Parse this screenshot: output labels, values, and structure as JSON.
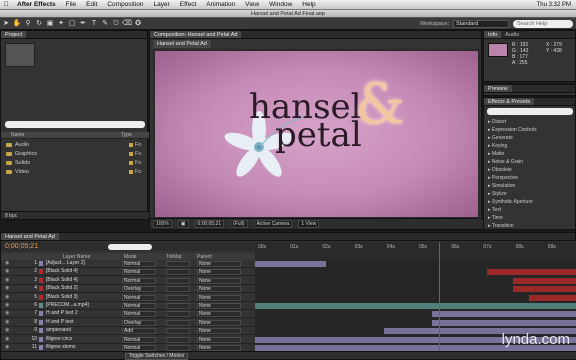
{
  "menubar": {
    "items": [
      "After Effects",
      "File",
      "Edit",
      "Composition",
      "Layer",
      "Effect",
      "Animation",
      "View",
      "Window",
      "Help"
    ],
    "right": "Thu 3:32 PM"
  },
  "window_title": "Hansel and Petal Ad Final.aep",
  "toolbar": {
    "workspace_label": "Workspace:",
    "workspace_value": "Standard",
    "search_placeholder": "Search Help"
  },
  "project": {
    "tab": "Project",
    "columns": [
      "Name",
      "Type"
    ],
    "items": [
      {
        "name": "Audio",
        "type": "Fo"
      },
      {
        "name": "Graphics",
        "type": "Fo"
      },
      {
        "name": "Solids",
        "type": "Fo"
      },
      {
        "name": "Video",
        "type": "Fo"
      }
    ],
    "bpc": "8 bpc"
  },
  "composition": {
    "tab": "Composition: Hansel and Petal Ad",
    "comp_name": "Hansel and Petal Ad",
    "title_line1": "hansel",
    "title_line2": "petal",
    "ampersand": "&",
    "zoom": "100%",
    "timecode": "0;00;05;21",
    "resolution": "(Full)",
    "camera": "Active Camera",
    "views": "1 View"
  },
  "info": {
    "tabs": [
      "Info",
      "Audio"
    ],
    "r": "R : 192",
    "g": "G : 143",
    "b": "B : 177",
    "a": "A : 255",
    "x": "X : 279",
    "y": "Y : 428",
    "swatch_color": "#b884a9"
  },
  "preview": {
    "tab": "Preview"
  },
  "effects": {
    "tab": "Effects & Presets",
    "items": [
      "Distort",
      "Expression Controls",
      "Generate",
      "Keying",
      "Matte",
      "Noise & Grain",
      "Obsolete",
      "Perspective",
      "Simulation",
      "Stylize",
      "Synthetic Aperture",
      "Text",
      "Time",
      "Transition"
    ]
  },
  "timeline": {
    "tab": "Hansel and Petal Ad",
    "timecode": "0;00;05;21",
    "columns": {
      "name": "Layer Name",
      "mode": "Mode",
      "trkmat": "TrkMat",
      "parent": "Parent"
    },
    "ruler": [
      "00s",
      "01s",
      "02s",
      "03s",
      "04s",
      "05s",
      "06s",
      "07s",
      "08s",
      "09s"
    ],
    "layers": [
      {
        "num": "1",
        "name": "[Adjust... Layer 2]",
        "mode": "Normal",
        "parent": "None",
        "label": "#8a7fb0"
      },
      {
        "num": "2",
        "name": "[Black Solid 4]",
        "mode": "Normal",
        "parent": "None",
        "label": "#b02a2a"
      },
      {
        "num": "3",
        "name": "[Black Solid 4]",
        "mode": "Normal",
        "parent": "None",
        "label": "#b02a2a"
      },
      {
        "num": "4",
        "name": "[Black Solid 2]",
        "mode": "Overlay",
        "parent": "None",
        "label": "#b02a2a"
      },
      {
        "num": "5",
        "name": "[Black Solid 3]",
        "mode": "Normal",
        "parent": "None",
        "label": "#b02a2a"
      },
      {
        "num": "6",
        "name": "[PRECOM...a.mp4]",
        "mode": "Normal",
        "parent": "None",
        "label": "#5a8f8a"
      },
      {
        "num": "7",
        "name": "H and P text 2",
        "mode": "Normal",
        "parent": "None",
        "label": "#8a7fb0"
      },
      {
        "num": "8",
        "name": "H and P text",
        "mode": "Overlay",
        "parent": "None",
        "label": "#8a7fb0"
      },
      {
        "num": "9",
        "name": "ampersand",
        "mode": "Add",
        "parent": "None",
        "label": "#8a7fb0"
      },
      {
        "num": "10",
        "name": "filigree circs",
        "mode": "Normal",
        "parent": "None",
        "label": "#8a7fb0"
      },
      {
        "num": "11",
        "name": "filigree stems",
        "mode": "Normal",
        "parent": "None",
        "label": "#8a7fb0"
      }
    ],
    "toggle_label": "Toggle Switches / Modes"
  },
  "watermark": "lynda.com"
}
